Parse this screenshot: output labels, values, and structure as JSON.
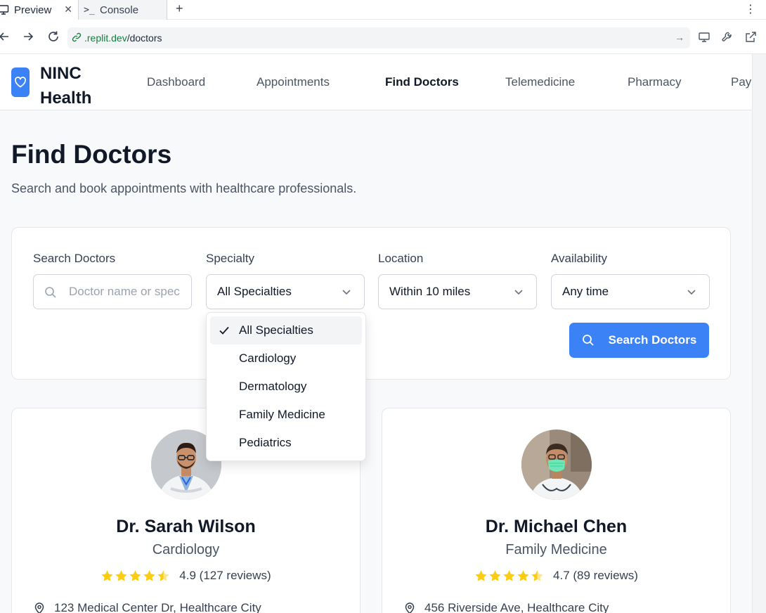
{
  "browser": {
    "tabs": [
      {
        "label": "Preview",
        "icon": "monitor-icon"
      },
      {
        "label": "Console",
        "icon": "terminal-icon"
      }
    ],
    "url_host": ".replit.dev",
    "url_path": "/doctors"
  },
  "app": {
    "brand": "NINC Health",
    "brand_icon": "heart-icon",
    "accent_color": "#3b82f6",
    "nav": [
      "Dashboard",
      "Appointments",
      "Find Doctors",
      "Telemedicine",
      "Pharmacy",
      "Payme"
    ],
    "active_nav": "Find Doctors"
  },
  "page": {
    "title": "Find Doctors",
    "subtitle": "Search and book appointments with healthcare professionals."
  },
  "search": {
    "search_label": "Search Doctors",
    "search_placeholder": "Doctor name or spec",
    "specialty_label": "Specialty",
    "specialty_value": "All Specialties",
    "location_label": "Location",
    "location_value": "Within 10 miles",
    "availability_label": "Availability",
    "availability_value": "Any time",
    "button_label": "Search Doctors"
  },
  "specialty_dropdown": {
    "options": [
      "All Specialties",
      "Cardiology",
      "Dermatology",
      "Family Medicine",
      "Pediatrics"
    ],
    "selected": "All Specialties"
  },
  "doctors": [
    {
      "name": "Dr. Sarah Wilson",
      "specialty": "Cardiology",
      "rating": "4.9",
      "stars": 4.5,
      "reviews": "(127 reviews)",
      "address": "123 Medical Center Dr, Healthcare City"
    },
    {
      "name": "Dr. Michael Chen",
      "specialty": "Family Medicine",
      "rating": "4.7",
      "stars": 4.5,
      "reviews": "(89 reviews)",
      "address": "456 Riverside Ave, Healthcare City"
    }
  ],
  "star_color": "#facc15"
}
